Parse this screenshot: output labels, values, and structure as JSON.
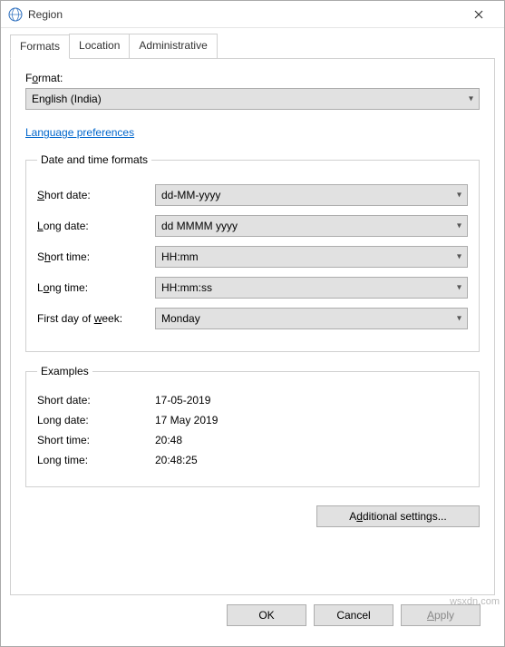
{
  "window": {
    "title": "Region"
  },
  "tabs": {
    "formats": "Formats",
    "location": "Location",
    "administrative": "Administrative"
  },
  "format_section": {
    "label_pre": "F",
    "label_u": "o",
    "label_post": "rmat:",
    "value": "English (India)"
  },
  "link": {
    "text": "Language preferences"
  },
  "dtf": {
    "legend": "Date and time formats",
    "short_date": {
      "pre": "",
      "u": "S",
      "post": "hort date:",
      "value": "dd-MM-yyyy"
    },
    "long_date": {
      "u": "L",
      "post": "ong date:",
      "value": "dd MMMM yyyy"
    },
    "short_time": {
      "pre": "S",
      "u": "h",
      "post": "ort time:",
      "value": "HH:mm"
    },
    "long_time": {
      "pre": "L",
      "u": "o",
      "post": "ng time:",
      "value": "HH:mm:ss"
    },
    "first_day": {
      "pre": "First day of ",
      "u": "w",
      "post": "eek:",
      "value": "Monday"
    }
  },
  "examples": {
    "legend": "Examples",
    "short_date": {
      "label": "Short date:",
      "value": "17-05-2019"
    },
    "long_date": {
      "label": "Long date:",
      "value": "17 May 2019"
    },
    "short_time": {
      "label": "Short time:",
      "value": "20:48"
    },
    "long_time": {
      "label": "Long time:",
      "value": "20:48:25"
    }
  },
  "buttons": {
    "additional_pre": "A",
    "additional_u": "d",
    "additional_post": "ditional settings...",
    "ok": "OK",
    "cancel": "Cancel",
    "apply_u": "A",
    "apply_post": "pply"
  },
  "watermark": "wsxdn.com"
}
